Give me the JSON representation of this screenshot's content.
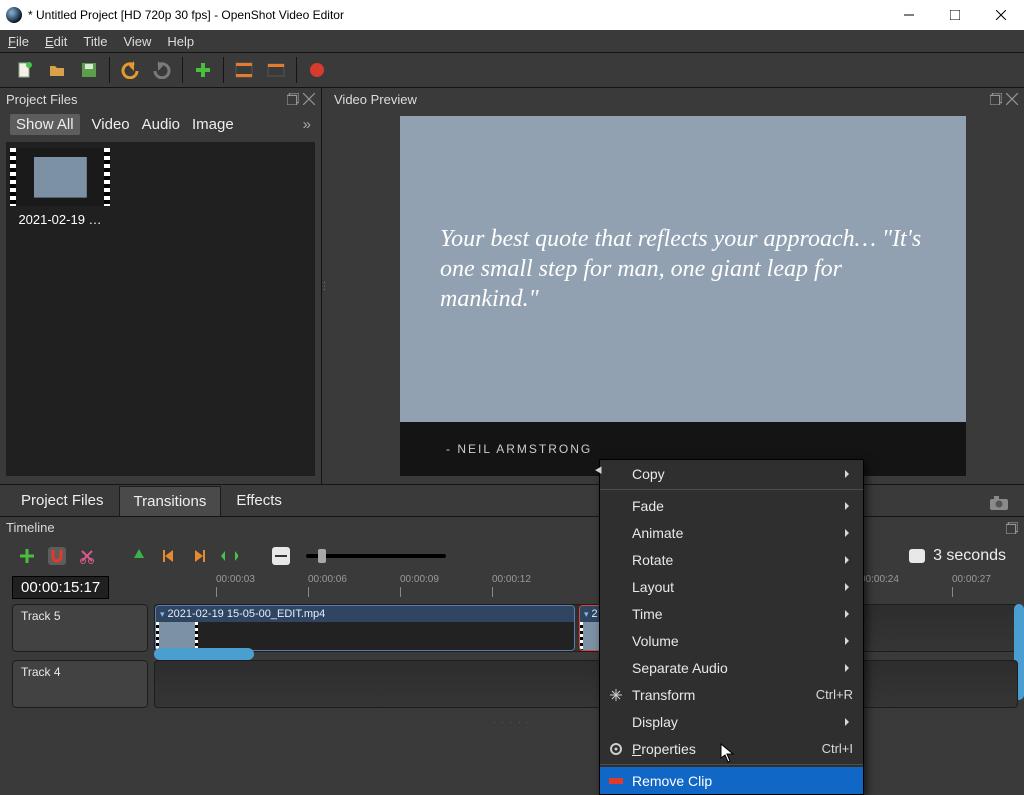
{
  "titlebar": {
    "title": "* Untitled Project [HD 720p 30 fps] - OpenShot Video Editor"
  },
  "menu": {
    "file": "File",
    "edit": "Edit",
    "title": "Title",
    "view": "View",
    "help": "Help"
  },
  "panels": {
    "project_files": "Project Files",
    "video_preview": "Video Preview",
    "timeline": "Timeline"
  },
  "filters": {
    "all": "Show All",
    "video": "Video",
    "audio": "Audio",
    "image": "Image"
  },
  "project_items": [
    {
      "name": "2021-02-19 …"
    }
  ],
  "preview": {
    "quote": "Your best quote that reflects your approach… \"It's one small step for man, one giant leap for mankind.\"",
    "attribution": "- NEIL ARMSTRONG"
  },
  "tabs": {
    "project_files": "Project Files",
    "transitions": "Transitions",
    "effects": "Effects"
  },
  "timeline": {
    "playhead": "00:00:15:17",
    "ruler": [
      "00:00:03",
      "00:00:06",
      "00:00:09",
      "00:00:12",
      "00:00:24",
      "00:00:27"
    ],
    "zoom_label": "3 seconds",
    "tracks": [
      "Track 5",
      "Track 4"
    ],
    "clip_name": "2021-02-19 15-05-00_EDIT.mp4"
  },
  "context": {
    "copy": "Copy",
    "fade": "Fade",
    "animate": "Animate",
    "rotate": "Rotate",
    "layout": "Layout",
    "time": "Time",
    "volume": "Volume",
    "sep_audio": "Separate Audio",
    "transform": "Transform",
    "display": "Display",
    "properties": "Properties",
    "remove": "Remove Clip",
    "sc_transform": "Ctrl+R",
    "sc_properties": "Ctrl+I"
  }
}
